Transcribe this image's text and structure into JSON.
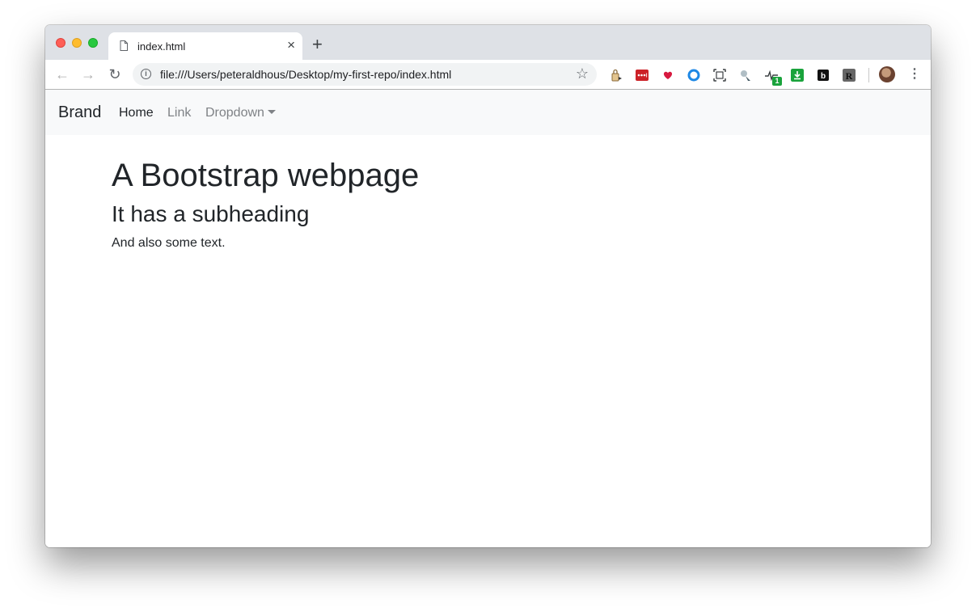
{
  "browser": {
    "tab": {
      "title": "index.html",
      "close_glyph": "×"
    },
    "new_tab_glyph": "+",
    "toolbar": {
      "back_glyph": "←",
      "forward_glyph": "→",
      "reload_glyph": "↻",
      "url": "file:///Users/peteraldhous/Desktop/my-first-repo/index.html",
      "info_glyph": "i",
      "star_glyph": "☆",
      "menu_glyph": "⋮"
    },
    "extensions": [
      {
        "name": "keychain-extension-icon",
        "color": "#c8a36a"
      },
      {
        "name": "lastpass-icon",
        "color": "#cc2127"
      },
      {
        "name": "pocket-heart-icon",
        "color": "#ef3f56"
      },
      {
        "name": "circle-ring-icon",
        "color": "#1e88e5"
      },
      {
        "name": "screenshot-frame-icon",
        "color": "#3c4043"
      },
      {
        "name": "satellite-icon",
        "color": "#7a8a99"
      },
      {
        "name": "pulse-icon",
        "color": "#3c4043"
      },
      {
        "name": "download-icon",
        "color": "#1aa33c"
      },
      {
        "name": "letter-b-icon",
        "color": "#111111"
      },
      {
        "name": "letter-r-icon",
        "color": "#555555"
      }
    ],
    "extension_badge": "1"
  },
  "page": {
    "navbar": {
      "brand": "Brand",
      "items": [
        "Home",
        "Link",
        "Dropdown"
      ]
    },
    "heading": "A Bootstrap webpage",
    "subheading": "It has a subheading",
    "text": "And also some text."
  }
}
